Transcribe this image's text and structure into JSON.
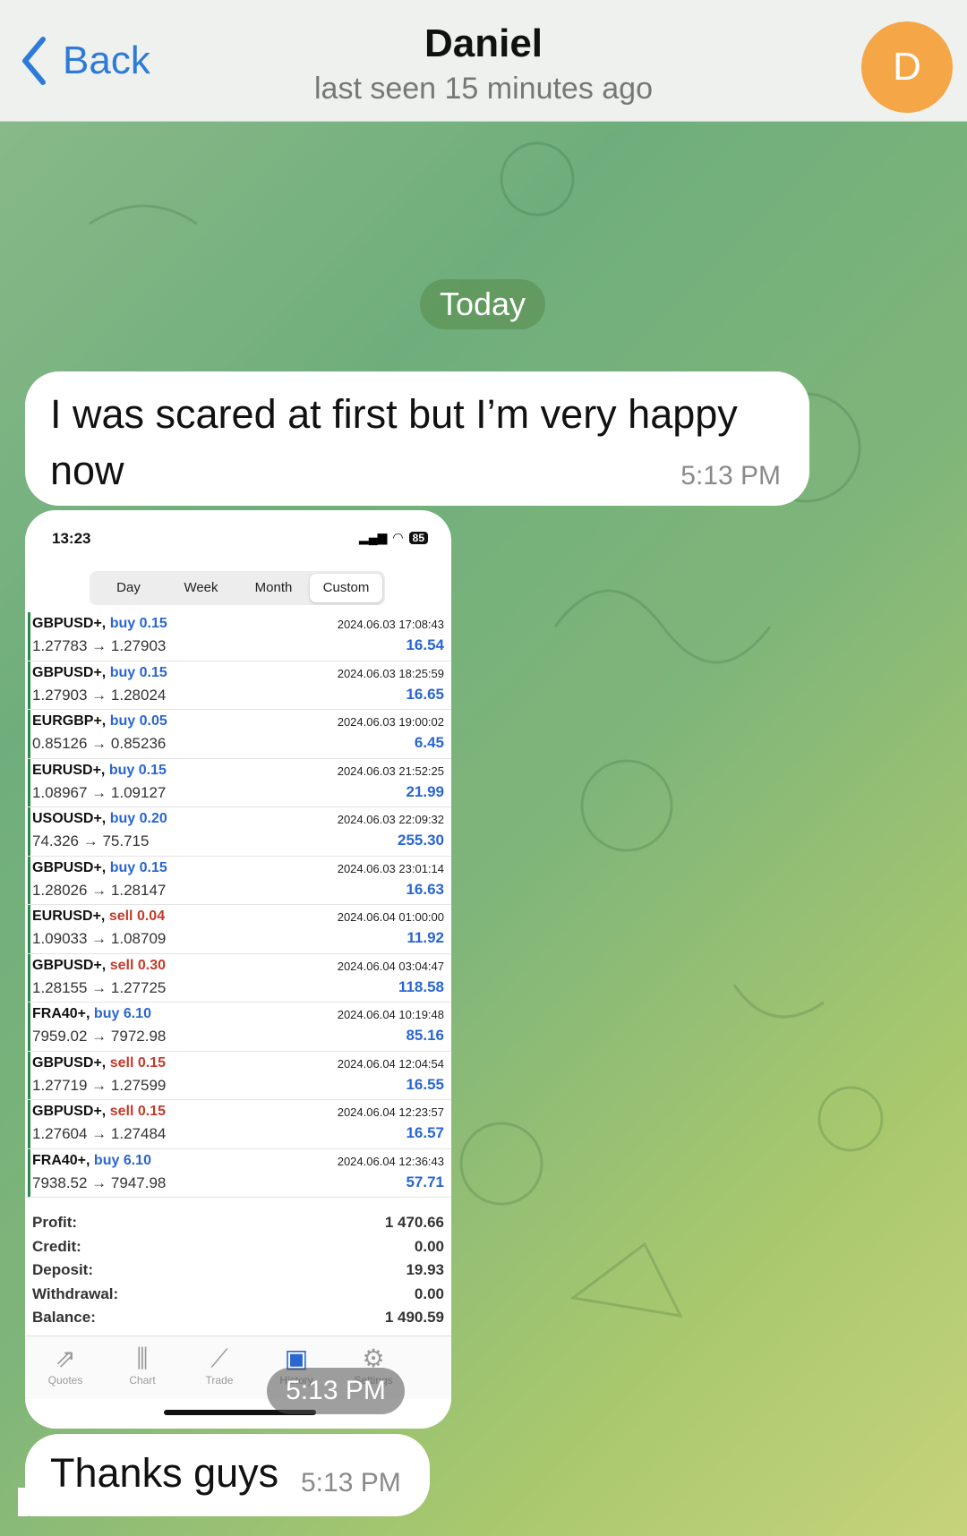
{
  "header": {
    "back_label": "Back",
    "contact_name": "Daniel",
    "last_seen": "last seen 15 minutes ago",
    "avatar_letter": "D"
  },
  "chat": {
    "date_separator": "Today",
    "messages": [
      {
        "text": "I was scared at first but I’m very happy now",
        "time": "5:13 PM"
      },
      {
        "type": "image",
        "time": "5:13 PM"
      },
      {
        "text": "Thanks guys",
        "time": "5:13 PM"
      }
    ]
  },
  "screenshot": {
    "clock": "13:23",
    "battery": "85",
    "periods": [
      "Day",
      "Week",
      "Month",
      "Custom"
    ],
    "active_period": "Custom",
    "trades": [
      {
        "symbol": "GBPUSD+,",
        "side": "buy",
        "volume": "0.15",
        "open": "1.27783",
        "close": "1.27903",
        "datetime": "2024.06.03 17:08:43",
        "profit": "16.54"
      },
      {
        "symbol": "GBPUSD+,",
        "side": "buy",
        "volume": "0.15",
        "open": "1.27903",
        "close": "1.28024",
        "datetime": "2024.06.03 18:25:59",
        "profit": "16.65"
      },
      {
        "symbol": "EURGBP+,",
        "side": "buy",
        "volume": "0.05",
        "open": "0.85126",
        "close": "0.85236",
        "datetime": "2024.06.03 19:00:02",
        "profit": "6.45"
      },
      {
        "symbol": "EURUSD+,",
        "side": "buy",
        "volume": "0.15",
        "open": "1.08967",
        "close": "1.09127",
        "datetime": "2024.06.03 21:52:25",
        "profit": "21.99"
      },
      {
        "symbol": "USOUSD+,",
        "side": "buy",
        "volume": "0.20",
        "open": "74.326",
        "close": "75.715",
        "datetime": "2024.06.03 22:09:32",
        "profit": "255.30"
      },
      {
        "symbol": "GBPUSD+,",
        "side": "buy",
        "volume": "0.15",
        "open": "1.28026",
        "close": "1.28147",
        "datetime": "2024.06.03 23:01:14",
        "profit": "16.63"
      },
      {
        "symbol": "EURUSD+,",
        "side": "sell",
        "volume": "0.04",
        "open": "1.09033",
        "close": "1.08709",
        "datetime": "2024.06.04 01:00:00",
        "profit": "11.92"
      },
      {
        "symbol": "GBPUSD+,",
        "side": "sell",
        "volume": "0.30",
        "open": "1.28155",
        "close": "1.27725",
        "datetime": "2024.06.04 03:04:47",
        "profit": "118.58"
      },
      {
        "symbol": "FRA40+,",
        "side": "buy",
        "volume": "6.10",
        "open": "7959.02",
        "close": "7972.98",
        "datetime": "2024.06.04 10:19:48",
        "profit": "85.16"
      },
      {
        "symbol": "GBPUSD+,",
        "side": "sell",
        "volume": "0.15",
        "open": "1.27719",
        "close": "1.27599",
        "datetime": "2024.06.04 12:04:54",
        "profit": "16.55"
      },
      {
        "symbol": "GBPUSD+,",
        "side": "sell",
        "volume": "0.15",
        "open": "1.27604",
        "close": "1.27484",
        "datetime": "2024.06.04 12:23:57",
        "profit": "16.57"
      },
      {
        "symbol": "FRA40+,",
        "side": "buy",
        "volume": "6.10",
        "open": "7938.52",
        "close": "7947.98",
        "datetime": "2024.06.04 12:36:43",
        "profit": "57.71"
      }
    ],
    "summary": [
      {
        "label": "Profit:",
        "value": "1 470.66"
      },
      {
        "label": "Credit:",
        "value": "0.00"
      },
      {
        "label": "Deposit:",
        "value": "19.93"
      },
      {
        "label": "Withdrawal:",
        "value": "0.00"
      },
      {
        "label": "Balance:",
        "value": "1 490.59"
      }
    ],
    "tabs": [
      {
        "label": "Quotes",
        "icon": "quotes-icon"
      },
      {
        "label": "Chart",
        "icon": "chart-icon"
      },
      {
        "label": "Trade",
        "icon": "trade-icon"
      },
      {
        "label": "History",
        "icon": "history-icon"
      },
      {
        "label": "Settings",
        "icon": "settings-icon"
      }
    ],
    "active_tab": "History"
  },
  "colors": {
    "accent_blue": "#2e7ad8",
    "avatar_orange": "#f5a646",
    "buy_blue": "#2a66d1",
    "sell_red": "#c33a2a"
  }
}
